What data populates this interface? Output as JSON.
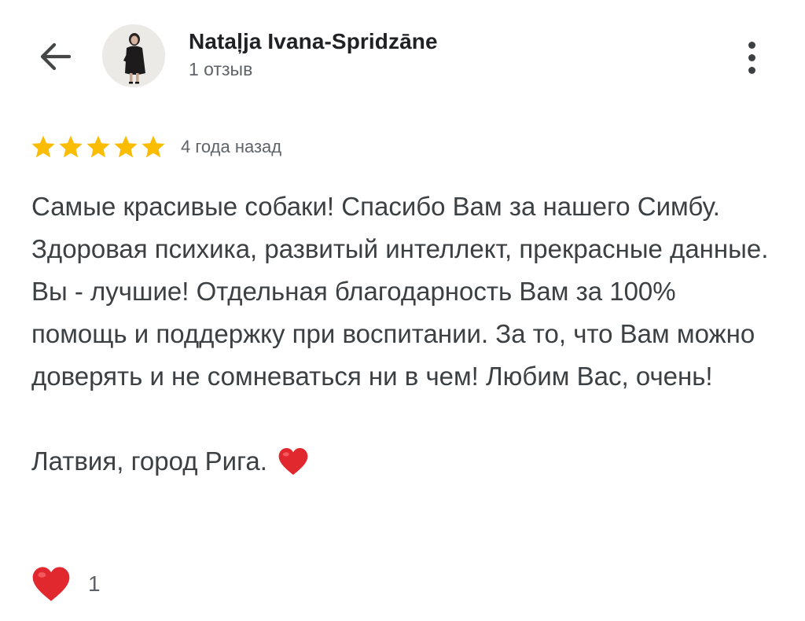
{
  "header": {
    "author_name": "Nataļja Ivana-Spridzāne",
    "review_count_label": "1 отзыв",
    "back_icon": "arrow-left-icon",
    "more_icon": "more-vert-icon"
  },
  "review": {
    "rating": 5,
    "max_rating": 5,
    "date": "4 года назад",
    "text": "Самые красивые собаки! Спасибо Вам за нашего Симбу. Здоровая психика, развитый интеллект, прекрасные данные. Вы - лучшие! Отдельная благодарность Вам за 100% помощь и поддержку при воспитании. За то, что Вам можно доверять и не сомневаться ни в чем! Любим Вас, очень!",
    "location": "Латвия, город Рига.",
    "location_emoji": "red-heart-emoji"
  },
  "reactions": {
    "like_icon": "red-heart-icon",
    "like_count": "1"
  },
  "colors": {
    "star": "#FBBC04",
    "heart": "#E0282E",
    "text": "#3C4043",
    "secondary_text": "#5F6368"
  }
}
